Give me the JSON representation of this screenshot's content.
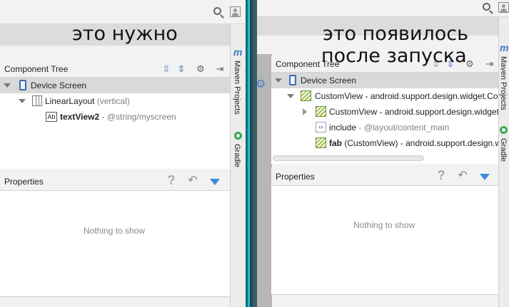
{
  "captions": {
    "left": "это нужно",
    "right_line1": "это появилось",
    "right_line2": "после запуска"
  },
  "icons": {
    "search": "search-icon",
    "user": "user-icon",
    "expand_all": "expand-all-icon",
    "collapse_all": "collapse-all-icon",
    "settings": "gear-icon",
    "hide": "hide-panel-icon",
    "help": "question-icon",
    "undo": "undo-icon",
    "filter": "filter-icon"
  },
  "left": {
    "component_tree": {
      "title": "Component Tree",
      "root": "Device Screen",
      "items": [
        {
          "name": "LinearLayout",
          "detail": "(vertical)"
        },
        {
          "name": "textView2",
          "detail": "- @string/myscreen"
        }
      ]
    },
    "properties": {
      "title": "Properties",
      "empty": "Nothing to show"
    },
    "side_tabs": {
      "maven": "Maven Projects",
      "gradle": "Gradle"
    }
  },
  "right": {
    "component_tree": {
      "title": "Component Tree",
      "root": "Device Screen",
      "items": [
        {
          "name": "CustomView",
          "detail": "- android.support.design.widget.Co"
        },
        {
          "name": "CustomView",
          "detail": "- android.support.design.widget"
        },
        {
          "name": "include",
          "detail": "- @layout/content_main"
        },
        {
          "name": "fab",
          "detail": "(CustomView) - android.support.design.w"
        }
      ]
    },
    "properties": {
      "title": "Properties",
      "empty": "Nothing to show"
    },
    "side_tabs": {
      "maven": "Maven Projects",
      "gradle": "Gradle"
    }
  },
  "colors": {
    "accent_blue": "#3b8cd6",
    "selection": "#d9d9d9",
    "divider_teal": "#2bb8c9"
  }
}
